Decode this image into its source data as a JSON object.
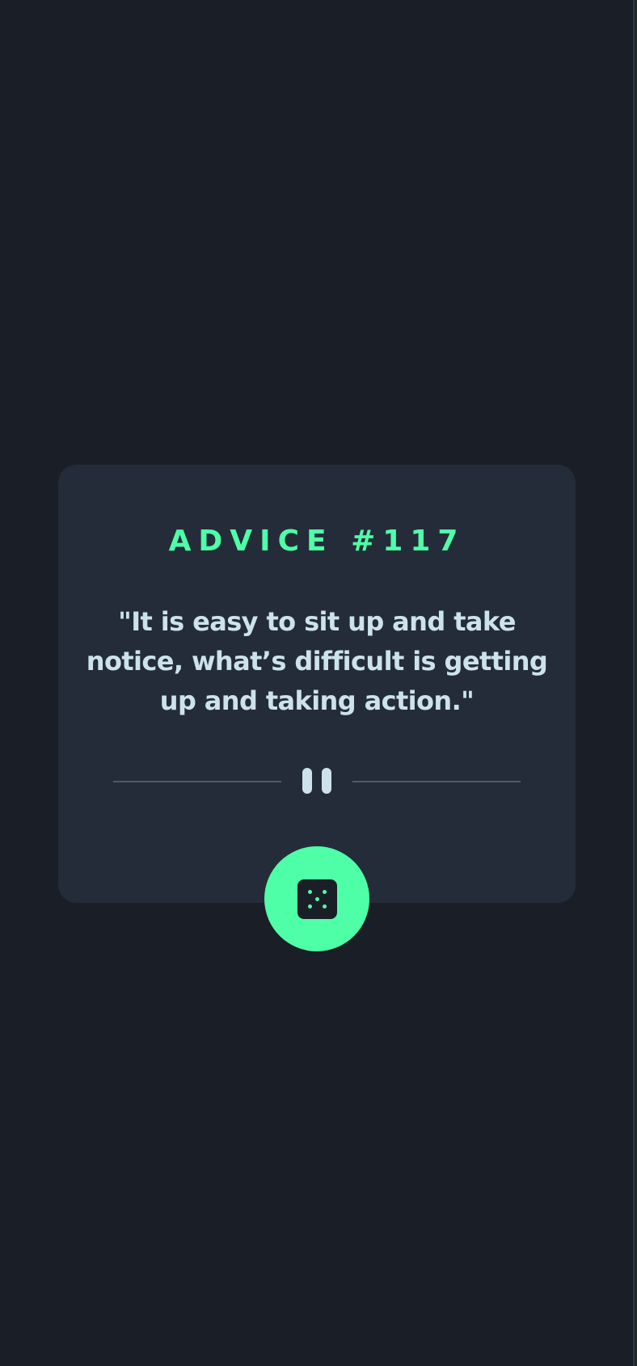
{
  "advice": {
    "title": "ADVICE #117",
    "quote": "\"It is easy to sit up and take notice, what’s difficult is getting up and taking action.\""
  },
  "icons": {
    "divider": "pause-icon",
    "button": "dice-icon"
  },
  "colors": {
    "background": "#1a1e26",
    "card": "#242c39",
    "accent": "#4fffa8",
    "text": "#cde3eb",
    "divider": "#4d5a6d"
  }
}
